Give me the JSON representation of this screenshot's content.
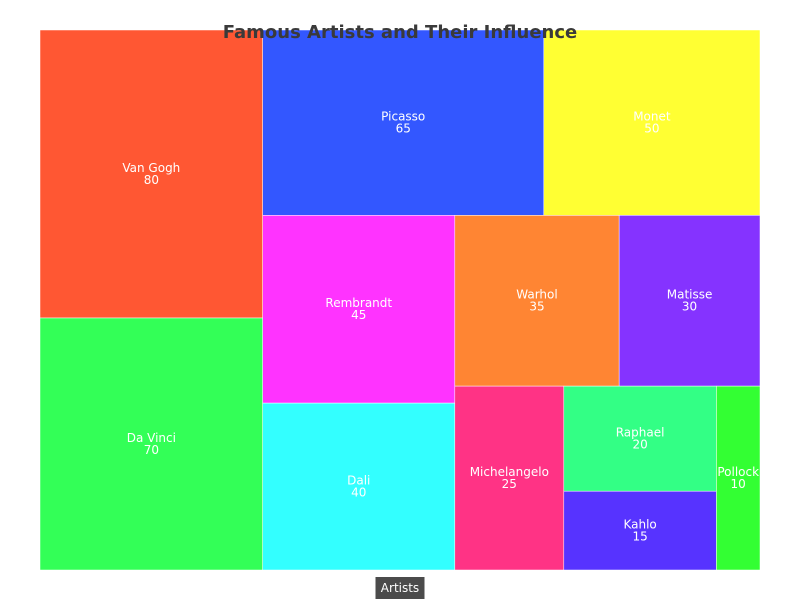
{
  "chart_data": {
    "type": "treemap",
    "title": "Famous Artists and Their Influence",
    "root_label": "Artists",
    "items": [
      {
        "name": "Van Gogh",
        "value": 80,
        "color": "#ff5733"
      },
      {
        "name": "Da Vinci",
        "value": 70,
        "color": "#33ff57"
      },
      {
        "name": "Picasso",
        "value": 65,
        "color": "#3357ff"
      },
      {
        "name": "Monet",
        "value": 50,
        "color": "#ffff33"
      },
      {
        "name": "Rembrandt",
        "value": 45,
        "color": "#ff33ff"
      },
      {
        "name": "Dali",
        "value": 40,
        "color": "#33ffff"
      },
      {
        "name": "Warhol",
        "value": 35,
        "color": "#ff8533"
      },
      {
        "name": "Matisse",
        "value": 30,
        "color": "#8533ff"
      },
      {
        "name": "Michelangelo",
        "value": 25,
        "color": "#ff3385"
      },
      {
        "name": "Raphael",
        "value": 20,
        "color": "#33ff85"
      },
      {
        "name": "Kahlo",
        "value": 15,
        "color": "#5733ff"
      },
      {
        "name": "Pollock",
        "value": 10,
        "color": "#33ff33"
      }
    ]
  }
}
